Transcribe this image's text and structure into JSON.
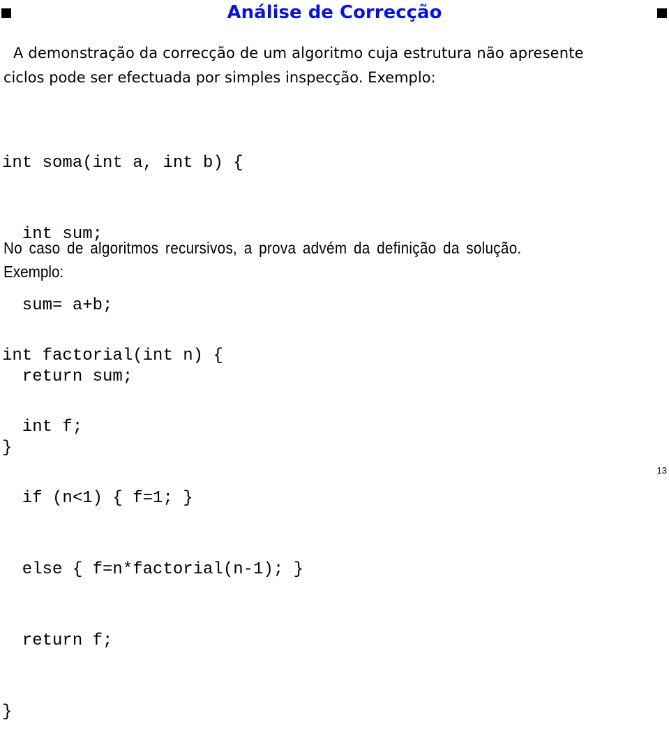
{
  "slide": {
    "title": "Análise de Correcção",
    "intro_line1": "A demonstração da correcção de um algoritmo cuja estrutura não apresente",
    "intro_line2": "ciclos pode ser efectuada por simples inspecção. Exemplo:",
    "code1": [
      "int soma(int a, int b) {",
      "  int sum;",
      "  sum= a+b;",
      "  return sum;",
      "}"
    ],
    "recursive_line1": "No caso de algoritmos recursivos, a prova advém da definição da solução.",
    "recursive_line2": "Exemplo:",
    "code2": [
      "int factorial(int n) {",
      "  int f;",
      "  if (n<1) { f=1; }",
      "  else { f=n*factorial(n-1); }",
      "  return f;",
      "}"
    ],
    "page_number": "13"
  },
  "colors": {
    "title": "#0a14d8",
    "text": "#000000"
  },
  "icons": {
    "bullet_left": "black-square",
    "bullet_right": "black-square"
  }
}
